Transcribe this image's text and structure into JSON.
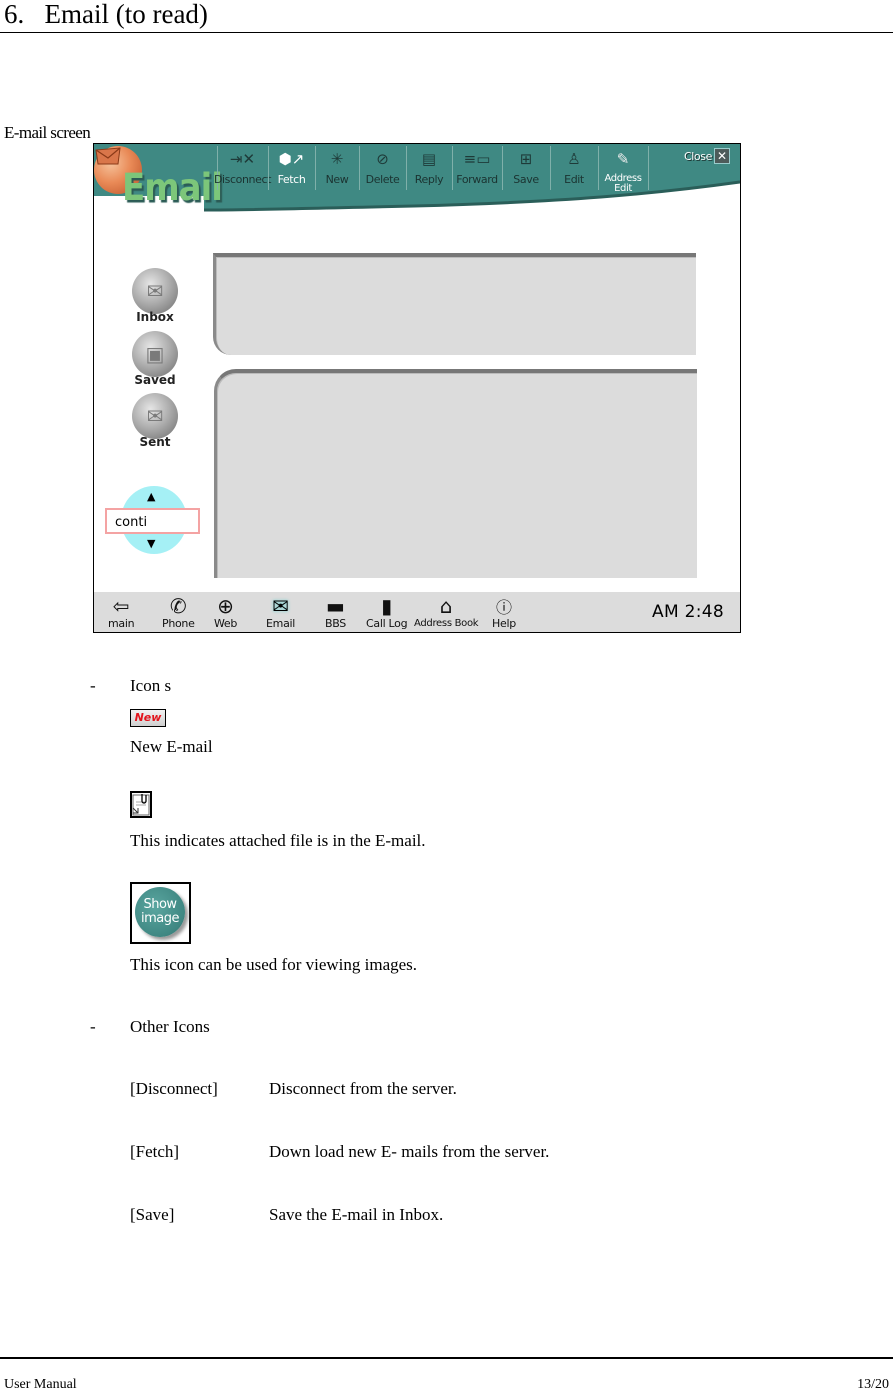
{
  "doc": {
    "heading": "6.   Email (to read)",
    "caption": "E-mail screen",
    "footer_left": "User  Manual",
    "footer_right": "13/20"
  },
  "app": {
    "logo_text": "Email",
    "colors": {
      "toolbar": "#3f8983",
      "panel": "#dcdcdc",
      "bottombar": "#dcdcdc",
      "spinner": "#a5f0f5",
      "spinner_field_border": "#f4a3a3",
      "logo_text": "#7cc67a"
    },
    "toolbar": [
      {
        "label": "Disconnect",
        "icon": "disconnect-icon",
        "selected": false
      },
      {
        "label": "Fetch",
        "icon": "fetch-icon",
        "selected": true
      },
      {
        "label": "New",
        "icon": "new-mail-icon",
        "selected": false
      },
      {
        "label": "Delete",
        "icon": "delete-icon",
        "selected": false
      },
      {
        "label": "Reply",
        "icon": "reply-icon",
        "selected": false
      },
      {
        "label": "Forward",
        "icon": "forward-icon",
        "selected": false
      },
      {
        "label": "Save",
        "icon": "save-icon",
        "selected": false
      },
      {
        "label": "Edit",
        "icon": "edit-icon",
        "selected": false
      },
      {
        "label": "Address Edit",
        "icon": "address-edit-icon",
        "selected": false
      }
    ],
    "close_label": "Close",
    "folders": [
      {
        "label": "Inbox",
        "icon": "inbox-icon"
      },
      {
        "label": "Saved",
        "icon": "floppy-disk-icon"
      },
      {
        "label": "Sent",
        "icon": "sent-mail-icon"
      }
    ],
    "spinner_value": "conti",
    "bottom_nav": [
      {
        "label": "main",
        "icon": "back-arrow-icon"
      },
      {
        "label": "Phone",
        "icon": "phone-icon"
      },
      {
        "label": "Web",
        "icon": "globe-icon"
      },
      {
        "label": "Email",
        "icon": "email-icon"
      },
      {
        "label": "BBS",
        "icon": "computer-icon"
      },
      {
        "label": "Call Log",
        "icon": "call-log-icon"
      },
      {
        "label": "Address Book",
        "icon": "address-book-icon"
      },
      {
        "label": "Help",
        "icon": "help-icon"
      }
    ],
    "clock": "AM 2:48"
  },
  "icons_section": {
    "bullet": "-",
    "title": "Icon s",
    "new_badge": "New",
    "new_desc": "New E-mail",
    "attach_desc": "This indicates attached file is in the E-mail.",
    "show_image_label": "Show image",
    "show_image_desc": "This icon can be used for viewing images."
  },
  "other_icons": {
    "bullet": "-",
    "title": "Other Icons",
    "items": [
      {
        "name": "[Disconnect]",
        "desc": "Disconnect from the server."
      },
      {
        "name": "[Fetch]",
        "desc": "Down load new E- mails from the server."
      },
      {
        "name": "[Save]",
        "desc": "Save the E-mail in Inbox."
      }
    ]
  }
}
